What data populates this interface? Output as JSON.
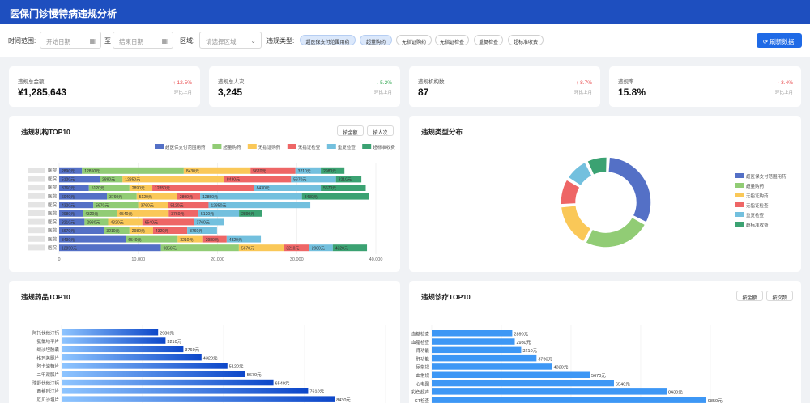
{
  "header": {
    "title": "医保门诊慢特病违规分析"
  },
  "filters": {
    "time_label": "时间范围:",
    "start_placeholder": "开始日期",
    "to_label": "至",
    "end_placeholder": "结束日期",
    "region_label": "区域:",
    "region_placeholder": "请选择区域",
    "type_label": "违规类型:",
    "types": [
      {
        "label": "超医保支付范围用药",
        "active": true
      },
      {
        "label": "超量购药",
        "active": true
      },
      {
        "label": "无指证购药",
        "active": false
      },
      {
        "label": "无指证检查",
        "active": false
      },
      {
        "label": "重复检查",
        "active": false
      },
      {
        "label": "超标准收费",
        "active": false
      }
    ],
    "refresh_label": "刷新数据"
  },
  "kpis": [
    {
      "label": "违规总金额",
      "value": "¥1,285,643",
      "change": "↑ 12.5%",
      "direction": "up",
      "sub": "环比上月"
    },
    {
      "label": "违规总人次",
      "value": "3,245",
      "change": "↓ 5.2%",
      "direction": "down",
      "sub": "环比上月"
    },
    {
      "label": "违规机构数",
      "value": "87",
      "change": "↑ 8.7%",
      "direction": "up",
      "sub": "环比上月"
    },
    {
      "label": "违规率",
      "value": "15.8%",
      "change": "↑ 3.4%",
      "direction": "up",
      "sub": "环比上月"
    }
  ],
  "panels": {
    "institutions": {
      "title": "违规机构TOP10",
      "btn_amount": "按金额",
      "btn_count": "按人次"
    },
    "types": {
      "title": "违规类型分布"
    },
    "drugs": {
      "title": "违规药品TOP10"
    },
    "treatments": {
      "title": "违规诊疗TOP10",
      "btn_amount": "按金额",
      "btn_count": "按次数"
    }
  },
  "colors": {
    "header": "#1e4fbf",
    "primary": "#1f6ae6",
    "up": "#e8484a",
    "down": "#33a853"
  },
  "chart_data": [
    {
      "type": "bar",
      "orientation": "horizontal",
      "stacked": true,
      "title": "违规机构TOP10",
      "categories_suffix": [
        "医院",
        "医院",
        "医院",
        "医院",
        "医院",
        "医院",
        "医院",
        "医院",
        "医院",
        "医院"
      ],
      "xticks": [
        "0",
        "10,000",
        "20,000",
        "30,000",
        "40,000"
      ],
      "xlim": [
        0,
        40000
      ],
      "legend_position": "top-right",
      "value_unit": "元",
      "series": [
        {
          "name": "超医保支付范围用药",
          "color": "#5470c6",
          "values": [
            2890,
            5120,
            3760,
            6040,
            4320,
            2980,
            3210,
            5670,
            8430,
            12850
          ]
        },
        {
          "name": "超量购药",
          "color": "#91cc75",
          "values": [
            12850,
            2890,
            5120,
            3760,
            5670,
            4320,
            2980,
            3210,
            6540,
            9850
          ]
        },
        {
          "name": "无指证购药",
          "color": "#fac858",
          "values": [
            8430,
            12850,
            2890,
            5120,
            3760,
            6540,
            4320,
            2980,
            3210,
            5670
          ]
        },
        {
          "name": "无指证检查",
          "color": "#ee6666",
          "values": [
            5670,
            8430,
            12850,
            2890,
            5120,
            3760,
            6540,
            4320,
            2980,
            3210
          ]
        },
        {
          "name": "重复检查",
          "color": "#73c0de",
          "values": [
            3210,
            5670,
            8430,
            12850,
            12850,
            5120,
            3760,
            3760,
            4320,
            2980
          ]
        },
        {
          "name": "超标准收费",
          "color": "#3ba272",
          "values": [
            2980,
            3210,
            5670,
            8430,
            0,
            2890,
            0,
            0,
            0,
            4320
          ]
        }
      ]
    },
    {
      "type": "pie",
      "donut": true,
      "title": "违规类型分布",
      "legend_position": "right",
      "labels": [
        "超医保支付范围用药",
        "超量购药",
        "无指证购药",
        "无指证检查",
        "重复检查",
        "超标准收费"
      ],
      "values": [
        32,
        25,
        16,
        10,
        9,
        8
      ],
      "colors": [
        "#5470c6",
        "#91cc75",
        "#fac858",
        "#ee6666",
        "#73c0de",
        "#3ba272"
      ]
    },
    {
      "type": "bar",
      "orientation": "horizontal",
      "title": "违规药品TOP10",
      "categories": [
        "阿托伐他汀钙",
        "氨氯地平片",
        "缬沙坦胶囊",
        "格列美脲片",
        "阿卡波糖片",
        "二甲双胍片",
        "瑞舒伐他汀钙",
        "西格列汀片",
        "厄贝沙坦片"
      ],
      "values": [
        2980,
        3210,
        3760,
        4320,
        5120,
        5670,
        6540,
        7610,
        8430
      ],
      "value_unit": "元",
      "bar_color": [
        "#8ec5ff",
        "#0d47c9"
      ]
    },
    {
      "type": "bar",
      "orientation": "horizontal",
      "title": "违规诊疗TOP10",
      "categories": [
        "血糖检查",
        "血脂检查",
        "肾功能",
        "肝功能",
        "尿常规",
        "血常规",
        "心电图",
        "彩色超声",
        "CT检查"
      ],
      "values": [
        2890,
        2980,
        3210,
        3760,
        4320,
        5670,
        6540,
        8430,
        9850
      ],
      "value_unit": "元",
      "bar_color": "#3d97f5"
    }
  ]
}
